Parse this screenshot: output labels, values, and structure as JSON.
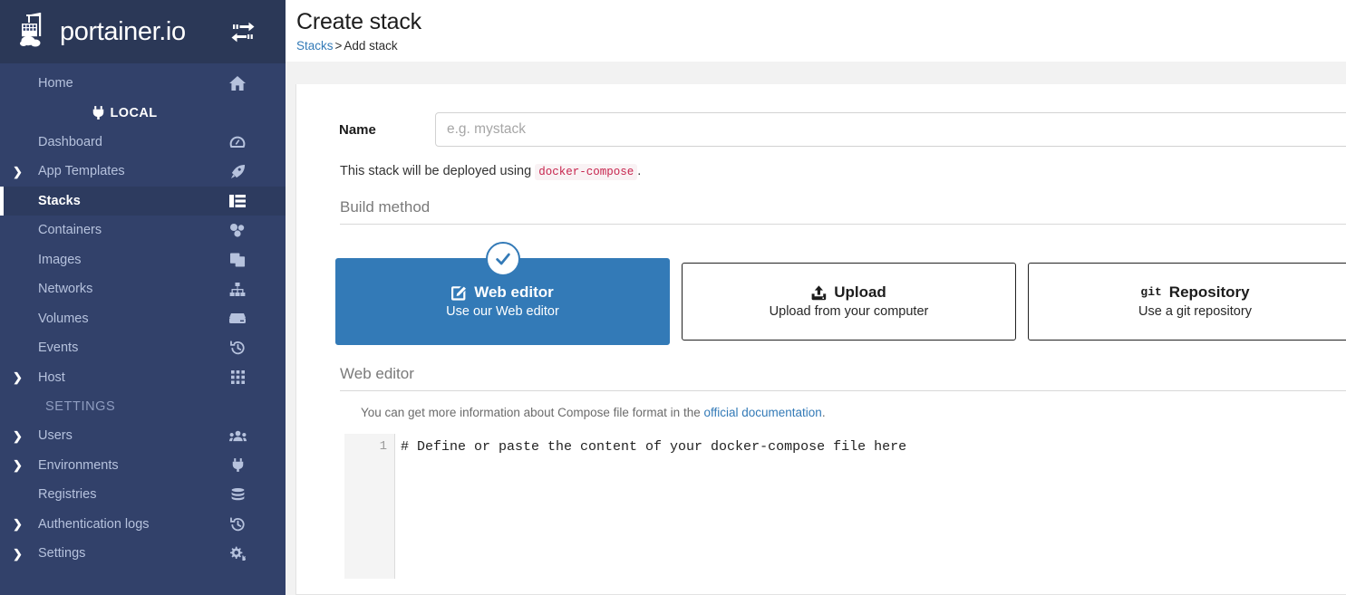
{
  "sidebar": {
    "brand": {
      "name": "portainer.io",
      "logo_icon": "portainer-crane-logo",
      "toggle_icon": "toggle-sidebar-arrows-icon"
    },
    "home": {
      "label": "Home",
      "icon": "home-icon"
    },
    "environment": {
      "label": "LOCAL",
      "icon": "plug-icon"
    },
    "items": [
      {
        "label": "Dashboard",
        "icon": "dashboard-gauge-icon",
        "caret": "",
        "active": false
      },
      {
        "label": "App Templates",
        "icon": "rocket-icon",
        "caret": "❯",
        "active": false
      },
      {
        "label": "Stacks",
        "icon": "stacks-table-icon",
        "caret": "",
        "active": true
      },
      {
        "label": "Containers",
        "icon": "containers-icon",
        "caret": "",
        "active": false
      },
      {
        "label": "Images",
        "icon": "images-copy-icon",
        "caret": "",
        "active": false
      },
      {
        "label": "Networks",
        "icon": "network-sitemap-icon",
        "caret": "",
        "active": false
      },
      {
        "label": "Volumes",
        "icon": "volume-hdd-icon",
        "caret": "",
        "active": false
      },
      {
        "label": "Events",
        "icon": "history-clock-icon",
        "caret": "",
        "active": false
      },
      {
        "label": "Host",
        "icon": "host-grid-icon",
        "caret": "❯",
        "active": false
      }
    ],
    "settings_section_label": "SETTINGS",
    "settings_items": [
      {
        "label": "Users",
        "icon": "users-group-icon",
        "caret": "❯",
        "active": false
      },
      {
        "label": "Environments",
        "icon": "plug-icon",
        "caret": "❯",
        "active": false
      },
      {
        "label": "Registries",
        "icon": "database-stack-icon",
        "caret": "",
        "active": false
      },
      {
        "label": "Authentication logs",
        "icon": "history-clock-icon",
        "caret": "❯",
        "active": false
      },
      {
        "label": "Settings",
        "icon": "cogs-icon",
        "caret": "❯",
        "active": false
      }
    ]
  },
  "header": {
    "title": "Create stack",
    "breadcrumb": {
      "root": "Stacks",
      "separator": ">",
      "current": "Add stack"
    }
  },
  "form": {
    "name_label": "Name",
    "name_value": "",
    "name_placeholder": "e.g. mystack",
    "deploy_note_prefix": "This stack will be deployed using",
    "deploy_note_code": "docker-compose",
    "deploy_note_suffix": "."
  },
  "build_method": {
    "heading": "Build method",
    "options": [
      {
        "title": "Web editor",
        "description": "Use our Web editor",
        "icon": "pencil-square-edit-icon",
        "selected": true,
        "badge_icon": "check-circle-icon"
      },
      {
        "title": "Upload",
        "description": "Upload from your computer",
        "icon": "upload-icon",
        "selected": false
      },
      {
        "title": "Repository",
        "description": "Use a git repository",
        "icon": "git-text-icon",
        "icon_text": "git",
        "selected": false
      }
    ]
  },
  "web_editor": {
    "heading": "Web editor",
    "note_prefix": "You can get more information about Compose file format in the",
    "note_link": "official documentation",
    "note_suffix": ".",
    "line_numbers": [
      "1"
    ],
    "content": "# Define or paste the content of your docker-compose file here"
  },
  "colors": {
    "sidebar_bg": "#32416a",
    "sidebar_header_bg": "#2b3857",
    "sidebar_active_bg": "#2d3b5f",
    "accent_blue": "#337ab7",
    "page_bg": "#f2f2f2",
    "code_pink": "#c7254e"
  }
}
